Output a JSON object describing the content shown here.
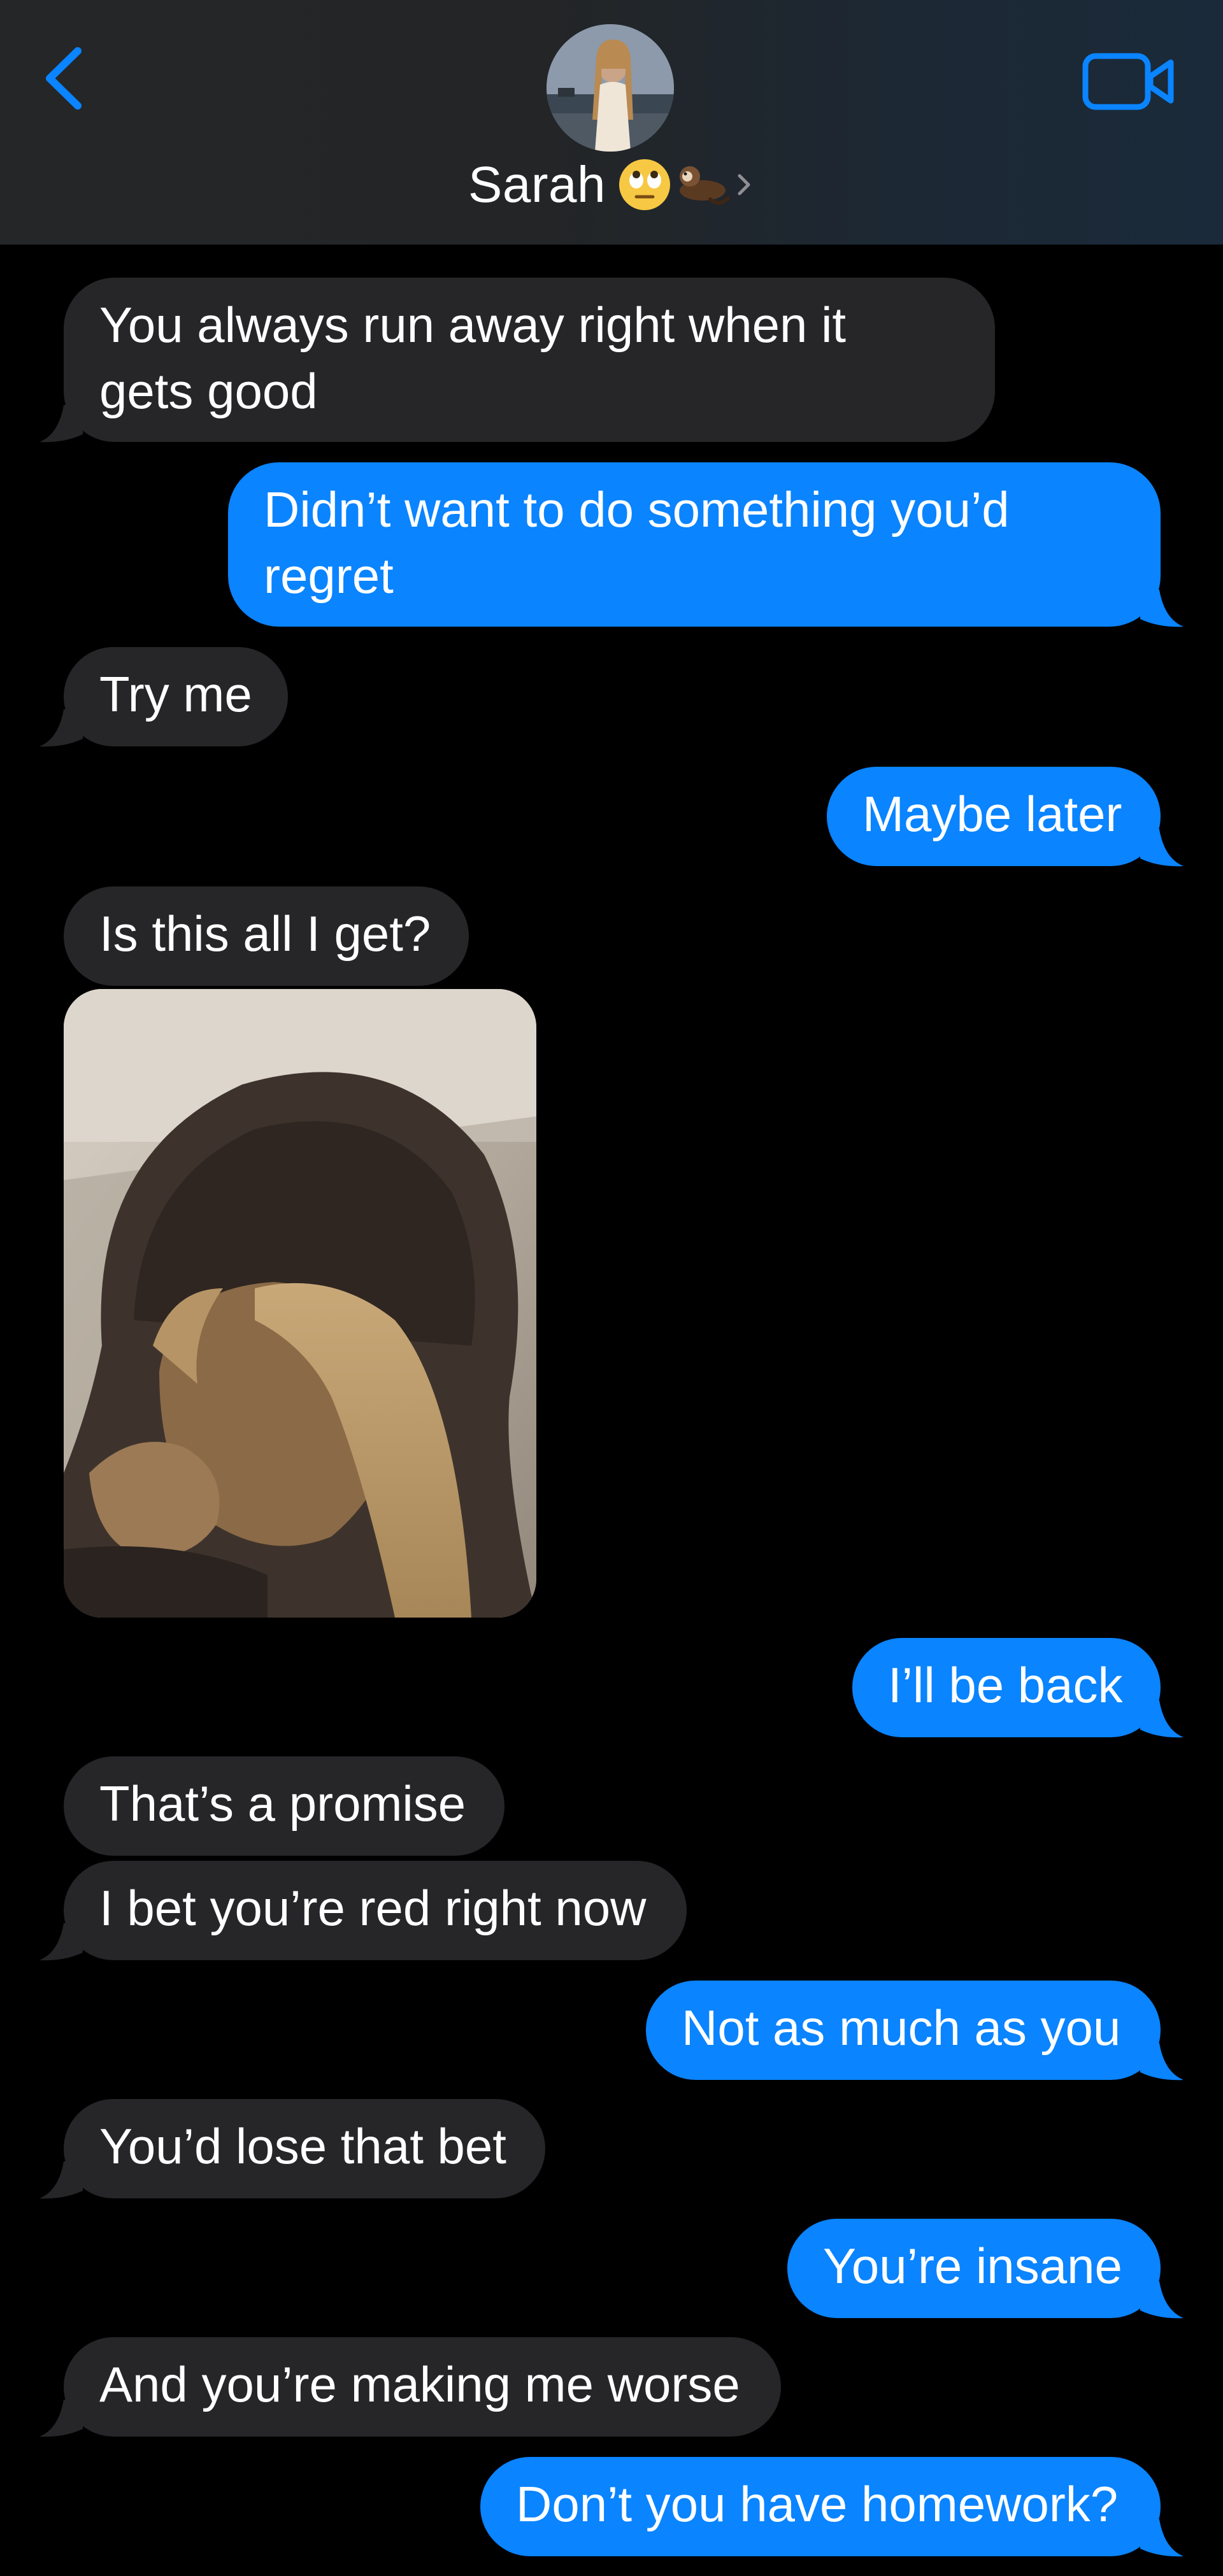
{
  "header": {
    "contact_name": "Sarah",
    "name_emojis": [
      "face-with-rolling-eyes",
      "otter"
    ],
    "avatar_icon": "profile-photo",
    "back_icon": "chevron-left-icon",
    "video_icon": "video-camera-icon"
  },
  "colors": {
    "sent_bubble": "#0a84ff",
    "received_bubble": "#262629",
    "accent": "#0a84ff",
    "background": "#000000"
  },
  "messages": [
    {
      "from": "received",
      "line1": "You always run away right when it",
      "line2": "gets good"
    },
    {
      "from": "sent",
      "line1": "Didn’t want to do something you’d",
      "line2": "regret"
    },
    {
      "from": "received",
      "text": "Try me"
    },
    {
      "from": "sent",
      "text": "Maybe later"
    },
    {
      "from": "received",
      "text": "Is this all I get?"
    },
    {
      "from": "received",
      "type": "photo",
      "description": "hooded-selfie"
    },
    {
      "from": "sent",
      "text": "I’ll be back"
    },
    {
      "from": "received",
      "text": "That’s a promise"
    },
    {
      "from": "received",
      "text": "I bet you’re red right now"
    },
    {
      "from": "sent",
      "text": "Not as much as you"
    },
    {
      "from": "received",
      "text": "You’d lose that bet"
    },
    {
      "from": "sent",
      "text": "You’re insane"
    },
    {
      "from": "received",
      "text": "And you’re making me worse"
    },
    {
      "from": "sent",
      "text": "Don’t you have homework?"
    }
  ]
}
